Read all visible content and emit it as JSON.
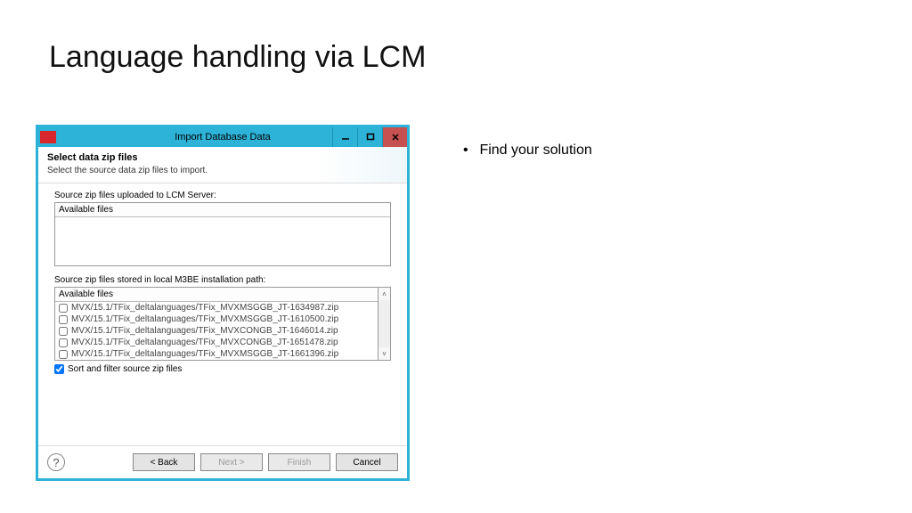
{
  "slide": {
    "title": "Language handling via LCM",
    "bullet1": "Find your solution"
  },
  "window": {
    "title": "Import Database Data",
    "appIcon": "infor",
    "header": {
      "title": "Select data zip files",
      "subtitle": "Select the source data zip files to import."
    },
    "section1": {
      "label": "Source zip files uploaded to LCM Server:",
      "listHeader": "Available files"
    },
    "section2": {
      "label": "Source zip files stored in local M3BE installation path:",
      "listHeader": "Available files",
      "files": [
        "MVX/15.1/TFix_deltalanguages/TFix_MVXMSGGB_JT-1634987.zip",
        "MVX/15.1/TFix_deltalanguages/TFix_MVXMSGGB_JT-1610500.zip",
        "MVX/15.1/TFix_deltalanguages/TFix_MVXCONGB_JT-1646014.zip",
        "MVX/15.1/TFix_deltalanguages/TFix_MVXCONGB_JT-1651478.zip",
        "MVX/15.1/TFix_deltalanguages/TFix_MVXMSGGB_JT-1661396.zip"
      ]
    },
    "sortFilter": "Sort and filter source zip files",
    "buttons": {
      "back": "< Back",
      "next": "Next >",
      "finish": "Finish",
      "cancel": "Cancel"
    }
  }
}
